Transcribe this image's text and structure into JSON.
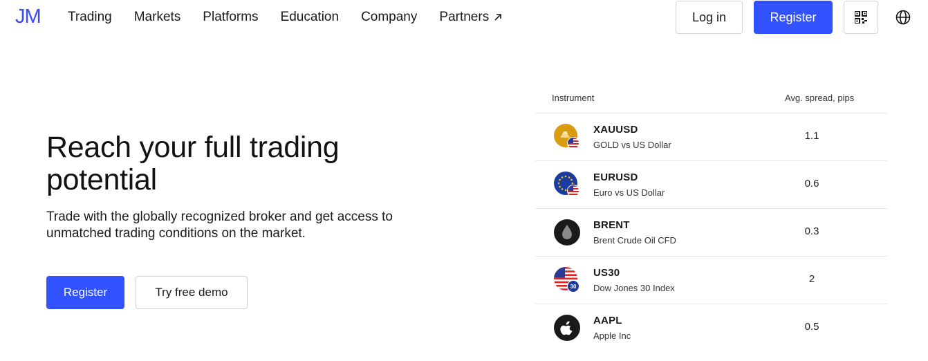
{
  "header": {
    "logo": "JM",
    "nav": [
      "Trading",
      "Markets",
      "Platforms",
      "Education",
      "Company",
      "Partners"
    ],
    "login_label": "Log in",
    "register_label": "Register",
    "qr_icon": "qr-code-icon",
    "globe_icon": "globe-icon"
  },
  "hero": {
    "title": "Reach your full trading potential",
    "subtitle": "Trade with the globally recognized broker and get access to unmatched trading conditions on the market.",
    "register_label": "Register",
    "demo_label": "Try free demo"
  },
  "instruments": {
    "col_instrument": "Instrument",
    "col_spread": "Avg. spread, pips",
    "rows": [
      {
        "symbol": "XAUUSD",
        "description": "GOLD vs US Dollar",
        "spread": "1.1",
        "icon": "gold-usd-icon"
      },
      {
        "symbol": "EURUSD",
        "description": "Euro vs US Dollar",
        "spread": "0.6",
        "icon": "eur-usd-icon"
      },
      {
        "symbol": "BRENT",
        "description": "Brent Crude Oil CFD",
        "spread": "0.3",
        "icon": "oil-drop-icon"
      },
      {
        "symbol": "US30",
        "description": "Dow Jones 30 Index",
        "spread": "2",
        "icon": "us30-flag-icon"
      },
      {
        "symbol": "AAPL",
        "description": "Apple Inc",
        "spread": "0.5",
        "icon": "apple-icon"
      }
    ]
  },
  "colors": {
    "accent": "#3352ff",
    "logo": "#3a4cf5",
    "gold": "#d99b0f",
    "eu_blue": "#1c3b9e"
  }
}
